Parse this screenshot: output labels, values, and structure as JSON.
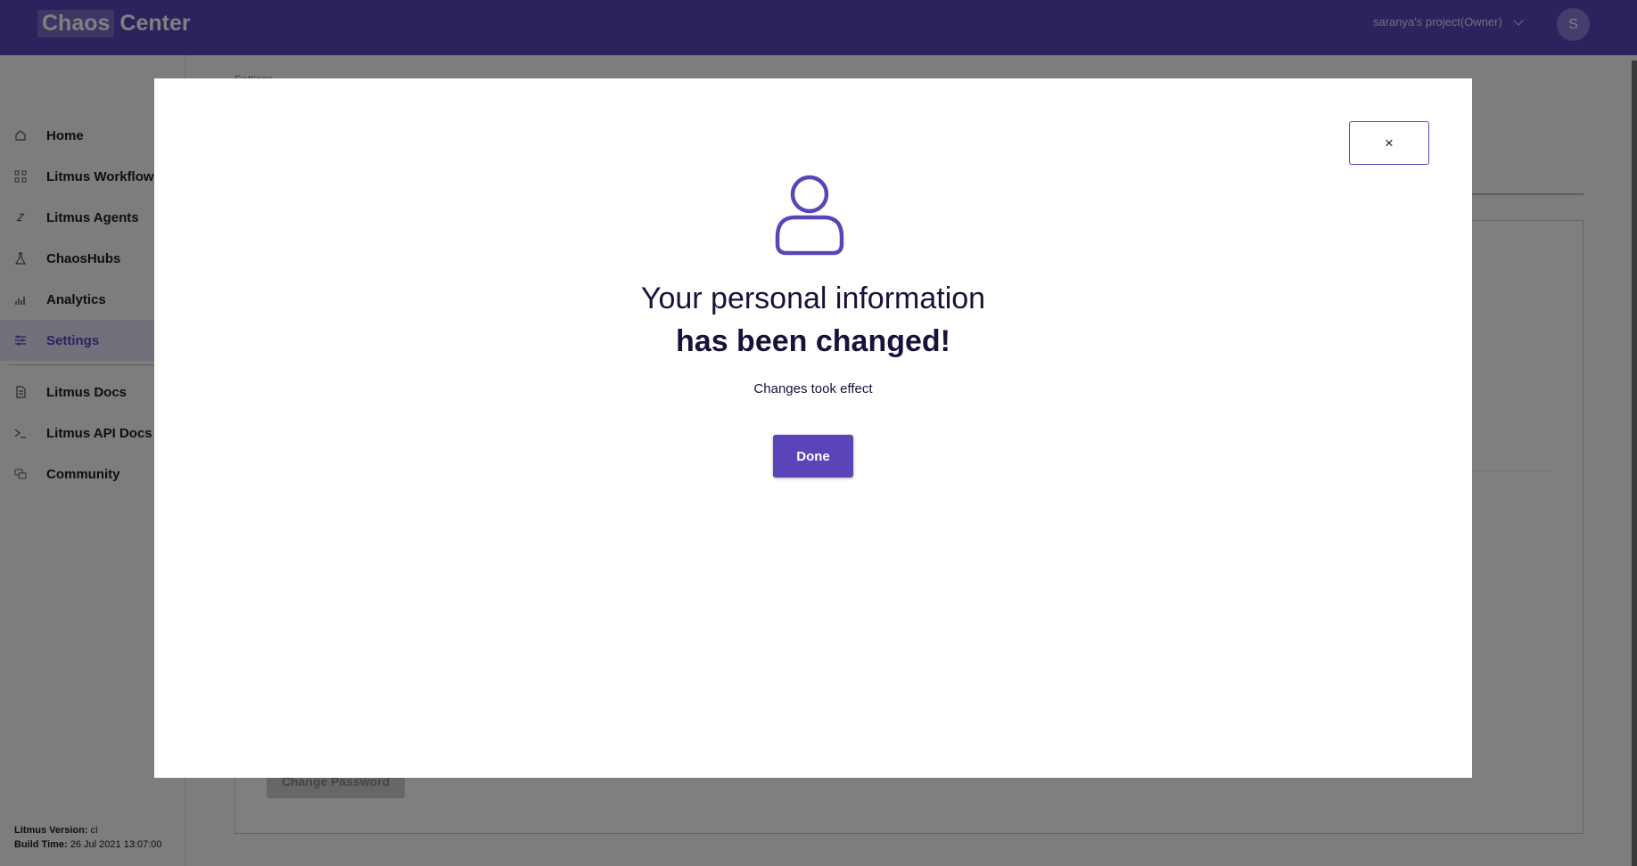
{
  "header": {
    "brand_part1": "Chaos",
    "brand_part2": "Center",
    "project": "saranya's project(Owner)",
    "avatar_initial": "S"
  },
  "sidebar": {
    "items": [
      {
        "label": "Home",
        "icon": "home-icon",
        "active": false
      },
      {
        "label": "Litmus Workflows",
        "icon": "workflows-icon",
        "active": false
      },
      {
        "label": "Litmus Agents",
        "icon": "agents-icon",
        "active": false
      },
      {
        "label": "ChaosHubs",
        "icon": "flask-icon",
        "active": false
      },
      {
        "label": "Analytics",
        "icon": "analytics-icon",
        "active": false
      },
      {
        "label": "Settings",
        "icon": "settings-icon",
        "active": true
      },
      {
        "label": "Litmus Docs",
        "icon": "docs-icon",
        "active": false
      },
      {
        "label": "Litmus API Docs",
        "icon": "terminal-icon",
        "active": false
      },
      {
        "label": "Community",
        "icon": "community-icon",
        "active": false
      }
    ],
    "version_label": "Litmus Version:",
    "version_value": "ci",
    "build_label": "Build Time:",
    "build_value": "26 Jul 2021 13:07:00"
  },
  "main": {
    "breadcrumb": "Settings",
    "change_password_button": "Change Password"
  },
  "modal": {
    "close_label": "×",
    "icon": "user-icon",
    "title_line1": "Your personal information",
    "title_line2": "has been changed!",
    "subtitle": "Changes took effect",
    "done_label": "Done"
  },
  "colors": {
    "brand": "#5b44ba",
    "overlay": "rgba(0,0,0,0.5)"
  }
}
